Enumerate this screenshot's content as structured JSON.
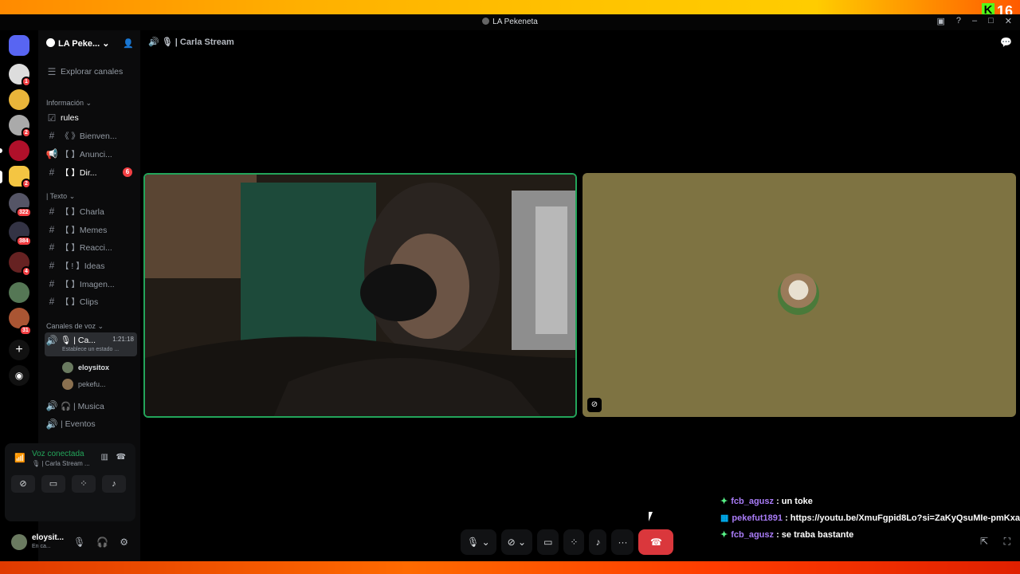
{
  "window": {
    "title": "LA Pekeneta",
    "overlay_number": "16"
  },
  "server": {
    "name": "LA Peke..."
  },
  "sidebar": {
    "explore": "Explorar canales",
    "cat_info": "Información",
    "cat_text": "| Texto",
    "cat_voice": "Canales de voz",
    "info_channels": [
      {
        "label": "rules"
      },
      {
        "label": "《 》Bienven..."
      },
      {
        "label": "【 】Anunci..."
      },
      {
        "label": "【 】Dir...",
        "unread": "6"
      }
    ],
    "text_channels": [
      {
        "label": "【 】Charla"
      },
      {
        "label": "【 】Memes"
      },
      {
        "label": "【 】Reacci..."
      },
      {
        "label": "【 ! 】Ideas"
      },
      {
        "label": "【 】Imagen..."
      },
      {
        "label": "【 】Clips"
      }
    ],
    "voice_active": {
      "label": "🎙 | Ca...",
      "time": "1:21:18",
      "status": "Establece un estado ..."
    },
    "voice_users": [
      "eloysitox",
      "pekefu..."
    ],
    "voice_other": [
      "🎧 | Musica",
      "| Eventos"
    ]
  },
  "voice_panel": {
    "title": "Voz conectada",
    "sub": "🎙 | Carla Stream ..."
  },
  "user": {
    "name": "eloysit...",
    "status": "En ca..."
  },
  "main": {
    "channel": "🎙 | Carla Stream"
  },
  "chat": [
    {
      "user": "fcb_agusz",
      "msg": ": un toke"
    },
    {
      "user": "pekefut1891",
      "msg": ": https://youtu.be/XmuFgpid8Lo?si=ZaKyQsuMIe-pmKxa"
    },
    {
      "user": "fcb_agusz",
      "msg": ": se traba bastante"
    }
  ],
  "guild_badges": [
    "1",
    "2",
    "2",
    "322",
    "384",
    "4",
    "31"
  ],
  "colors": {
    "connected": "#23a55a",
    "hangup": "#da373c",
    "mention": "#f23f43"
  }
}
